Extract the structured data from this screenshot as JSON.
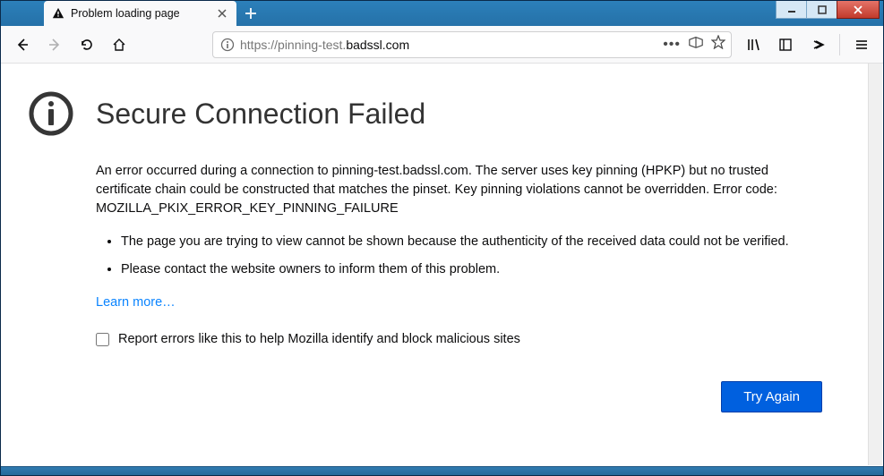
{
  "tab": {
    "title": "Problem loading page"
  },
  "url": {
    "scheme": "https://",
    "sub": "pinning-test.",
    "host": "badssl.com"
  },
  "error": {
    "title": "Secure Connection Failed",
    "description": "An error occurred during a connection to pinning-test.badssl.com. The server uses key pinning (HPKP) but no trusted certificate chain could be constructed that matches the pinset. Key pinning violations cannot be overridden. Error code: MOZILLA_PKIX_ERROR_KEY_PINNING_FAILURE",
    "bullets": [
      "The page you are trying to view cannot be shown because the authenticity of the received data could not be verified.",
      "Please contact the website owners to inform them of this problem."
    ],
    "learn_more": "Learn more…",
    "report_label": "Report errors like this to help Mozilla identify and block malicious sites",
    "try_again": "Try Again"
  }
}
